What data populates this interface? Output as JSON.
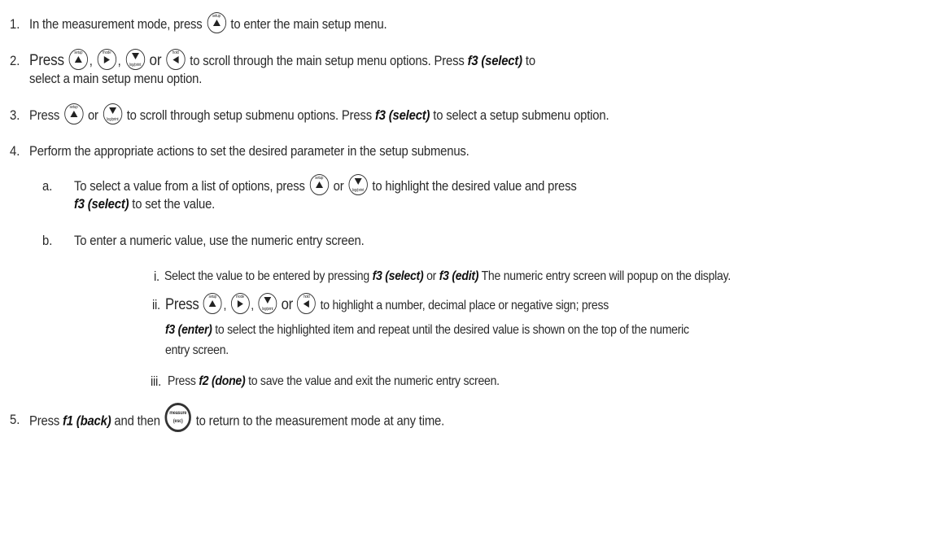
{
  "step1": {
    "num": "1.",
    "pre": "In the measurement mode, press",
    "post": "to enter the main setup menu."
  },
  "step2": {
    "num": "2.",
    "pre": "Press",
    "sep1": ",",
    "sep2": ",",
    "or": "or",
    "mid": "to scroll through the main setup menu options. Press",
    "cmd": "f3 (select)",
    "end": "to",
    "line2": "select a main setup menu option."
  },
  "step3": {
    "num": "3.",
    "pre": "Press",
    "or": "or",
    "mid": "to scroll through setup submenu options. Press",
    "cmd": "f3 (select)",
    "end": "to select a setup submenu option."
  },
  "step4": {
    "num": "4.",
    "text": "Perform the appropriate actions to set the desired parameter in the setup submenus."
  },
  "step4a": {
    "num": "a.",
    "pre": "To select a value from a list of options, press",
    "or": "or",
    "mid": "to highlight the desired value and press",
    "cmd": "f3 (select)",
    "end": "to set the value."
  },
  "step4b": {
    "num": "b.",
    "text": "To enter a numeric value, use the numeric entry screen."
  },
  "step4bi": {
    "num": "i.",
    "pre": "Select the value to be entered by pressing",
    "cmd1": "f3 (select)",
    "or": "or",
    "cmd2": "f3 (edit)",
    "end": "The numeric entry screen will popup on the display."
  },
  "step4bii": {
    "num": "ii.",
    "pre": "Press",
    "sep1": ",",
    "sep2": ",",
    "or": "or",
    "mid": "to highlight a number, decimal place or negative sign; press",
    "cmd": "f3 (enter)",
    "end": "to select the highlighted item and repeat until the desired value is shown on the top of the numeric",
    "line3": "entry screen."
  },
  "step4biii": {
    "num": "iii.",
    "pre": "Press",
    "cmd": "f2 (done)",
    "end": "to save the value and exit the numeric entry screen."
  },
  "step5": {
    "num": "5.",
    "pre": "Press",
    "cmd": "f1 (back)",
    "mid": "and then",
    "end": "to return to the measurement mode at any time."
  },
  "buttons": {
    "setup": {
      "top": "setup",
      "bottom": "",
      "icon": "arrow-up-icon"
    },
    "mode": {
      "top": "mode",
      "bottom": "",
      "icon": "arrow-right-icon"
    },
    "log": {
      "top": "",
      "bottom": "log/print",
      "icon": "arrow-down-icon"
    },
    "hold": {
      "top": "hold",
      "bottom": "",
      "icon": "arrow-left-icon"
    },
    "measure": {
      "top": "measure",
      "bottom": "(esc)",
      "icon": "measure-icon"
    }
  }
}
